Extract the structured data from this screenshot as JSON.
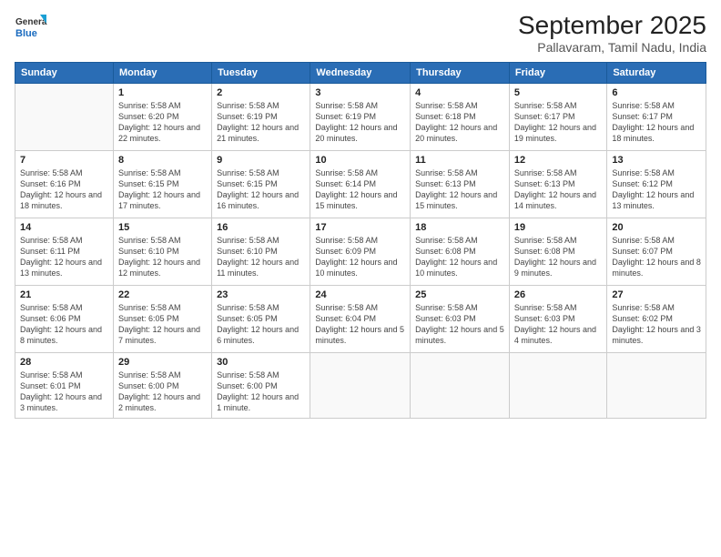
{
  "header": {
    "logo_line1": "General",
    "logo_line2": "Blue",
    "month": "September 2025",
    "location": "Pallavaram, Tamil Nadu, India"
  },
  "days_of_week": [
    "Sunday",
    "Monday",
    "Tuesday",
    "Wednesday",
    "Thursday",
    "Friday",
    "Saturday"
  ],
  "weeks": [
    [
      {
        "day": "",
        "sunrise": "",
        "sunset": "",
        "daylight": ""
      },
      {
        "day": "1",
        "sunrise": "Sunrise: 5:58 AM",
        "sunset": "Sunset: 6:20 PM",
        "daylight": "Daylight: 12 hours and 22 minutes."
      },
      {
        "day": "2",
        "sunrise": "Sunrise: 5:58 AM",
        "sunset": "Sunset: 6:19 PM",
        "daylight": "Daylight: 12 hours and 21 minutes."
      },
      {
        "day": "3",
        "sunrise": "Sunrise: 5:58 AM",
        "sunset": "Sunset: 6:19 PM",
        "daylight": "Daylight: 12 hours and 20 minutes."
      },
      {
        "day": "4",
        "sunrise": "Sunrise: 5:58 AM",
        "sunset": "Sunset: 6:18 PM",
        "daylight": "Daylight: 12 hours and 20 minutes."
      },
      {
        "day": "5",
        "sunrise": "Sunrise: 5:58 AM",
        "sunset": "Sunset: 6:17 PM",
        "daylight": "Daylight: 12 hours and 19 minutes."
      },
      {
        "day": "6",
        "sunrise": "Sunrise: 5:58 AM",
        "sunset": "Sunset: 6:17 PM",
        "daylight": "Daylight: 12 hours and 18 minutes."
      }
    ],
    [
      {
        "day": "7",
        "sunrise": "Sunrise: 5:58 AM",
        "sunset": "Sunset: 6:16 PM",
        "daylight": "Daylight: 12 hours and 18 minutes."
      },
      {
        "day": "8",
        "sunrise": "Sunrise: 5:58 AM",
        "sunset": "Sunset: 6:15 PM",
        "daylight": "Daylight: 12 hours and 17 minutes."
      },
      {
        "day": "9",
        "sunrise": "Sunrise: 5:58 AM",
        "sunset": "Sunset: 6:15 PM",
        "daylight": "Daylight: 12 hours and 16 minutes."
      },
      {
        "day": "10",
        "sunrise": "Sunrise: 5:58 AM",
        "sunset": "Sunset: 6:14 PM",
        "daylight": "Daylight: 12 hours and 15 minutes."
      },
      {
        "day": "11",
        "sunrise": "Sunrise: 5:58 AM",
        "sunset": "Sunset: 6:13 PM",
        "daylight": "Daylight: 12 hours and 15 minutes."
      },
      {
        "day": "12",
        "sunrise": "Sunrise: 5:58 AM",
        "sunset": "Sunset: 6:13 PM",
        "daylight": "Daylight: 12 hours and 14 minutes."
      },
      {
        "day": "13",
        "sunrise": "Sunrise: 5:58 AM",
        "sunset": "Sunset: 6:12 PM",
        "daylight": "Daylight: 12 hours and 13 minutes."
      }
    ],
    [
      {
        "day": "14",
        "sunrise": "Sunrise: 5:58 AM",
        "sunset": "Sunset: 6:11 PM",
        "daylight": "Daylight: 12 hours and 13 minutes."
      },
      {
        "day": "15",
        "sunrise": "Sunrise: 5:58 AM",
        "sunset": "Sunset: 6:10 PM",
        "daylight": "Daylight: 12 hours and 12 minutes."
      },
      {
        "day": "16",
        "sunrise": "Sunrise: 5:58 AM",
        "sunset": "Sunset: 6:10 PM",
        "daylight": "Daylight: 12 hours and 11 minutes."
      },
      {
        "day": "17",
        "sunrise": "Sunrise: 5:58 AM",
        "sunset": "Sunset: 6:09 PM",
        "daylight": "Daylight: 12 hours and 10 minutes."
      },
      {
        "day": "18",
        "sunrise": "Sunrise: 5:58 AM",
        "sunset": "Sunset: 6:08 PM",
        "daylight": "Daylight: 12 hours and 10 minutes."
      },
      {
        "day": "19",
        "sunrise": "Sunrise: 5:58 AM",
        "sunset": "Sunset: 6:08 PM",
        "daylight": "Daylight: 12 hours and 9 minutes."
      },
      {
        "day": "20",
        "sunrise": "Sunrise: 5:58 AM",
        "sunset": "Sunset: 6:07 PM",
        "daylight": "Daylight: 12 hours and 8 minutes."
      }
    ],
    [
      {
        "day": "21",
        "sunrise": "Sunrise: 5:58 AM",
        "sunset": "Sunset: 6:06 PM",
        "daylight": "Daylight: 12 hours and 8 minutes."
      },
      {
        "day": "22",
        "sunrise": "Sunrise: 5:58 AM",
        "sunset": "Sunset: 6:05 PM",
        "daylight": "Daylight: 12 hours and 7 minutes."
      },
      {
        "day": "23",
        "sunrise": "Sunrise: 5:58 AM",
        "sunset": "Sunset: 6:05 PM",
        "daylight": "Daylight: 12 hours and 6 minutes."
      },
      {
        "day": "24",
        "sunrise": "Sunrise: 5:58 AM",
        "sunset": "Sunset: 6:04 PM",
        "daylight": "Daylight: 12 hours and 5 minutes."
      },
      {
        "day": "25",
        "sunrise": "Sunrise: 5:58 AM",
        "sunset": "Sunset: 6:03 PM",
        "daylight": "Daylight: 12 hours and 5 minutes."
      },
      {
        "day": "26",
        "sunrise": "Sunrise: 5:58 AM",
        "sunset": "Sunset: 6:03 PM",
        "daylight": "Daylight: 12 hours and 4 minutes."
      },
      {
        "day": "27",
        "sunrise": "Sunrise: 5:58 AM",
        "sunset": "Sunset: 6:02 PM",
        "daylight": "Daylight: 12 hours and 3 minutes."
      }
    ],
    [
      {
        "day": "28",
        "sunrise": "Sunrise: 5:58 AM",
        "sunset": "Sunset: 6:01 PM",
        "daylight": "Daylight: 12 hours and 3 minutes."
      },
      {
        "day": "29",
        "sunrise": "Sunrise: 5:58 AM",
        "sunset": "Sunset: 6:00 PM",
        "daylight": "Daylight: 12 hours and 2 minutes."
      },
      {
        "day": "30",
        "sunrise": "Sunrise: 5:58 AM",
        "sunset": "Sunset: 6:00 PM",
        "daylight": "Daylight: 12 hours and 1 minute."
      },
      {
        "day": "",
        "sunrise": "",
        "sunset": "",
        "daylight": ""
      },
      {
        "day": "",
        "sunrise": "",
        "sunset": "",
        "daylight": ""
      },
      {
        "day": "",
        "sunrise": "",
        "sunset": "",
        "daylight": ""
      },
      {
        "day": "",
        "sunrise": "",
        "sunset": "",
        "daylight": ""
      }
    ]
  ]
}
